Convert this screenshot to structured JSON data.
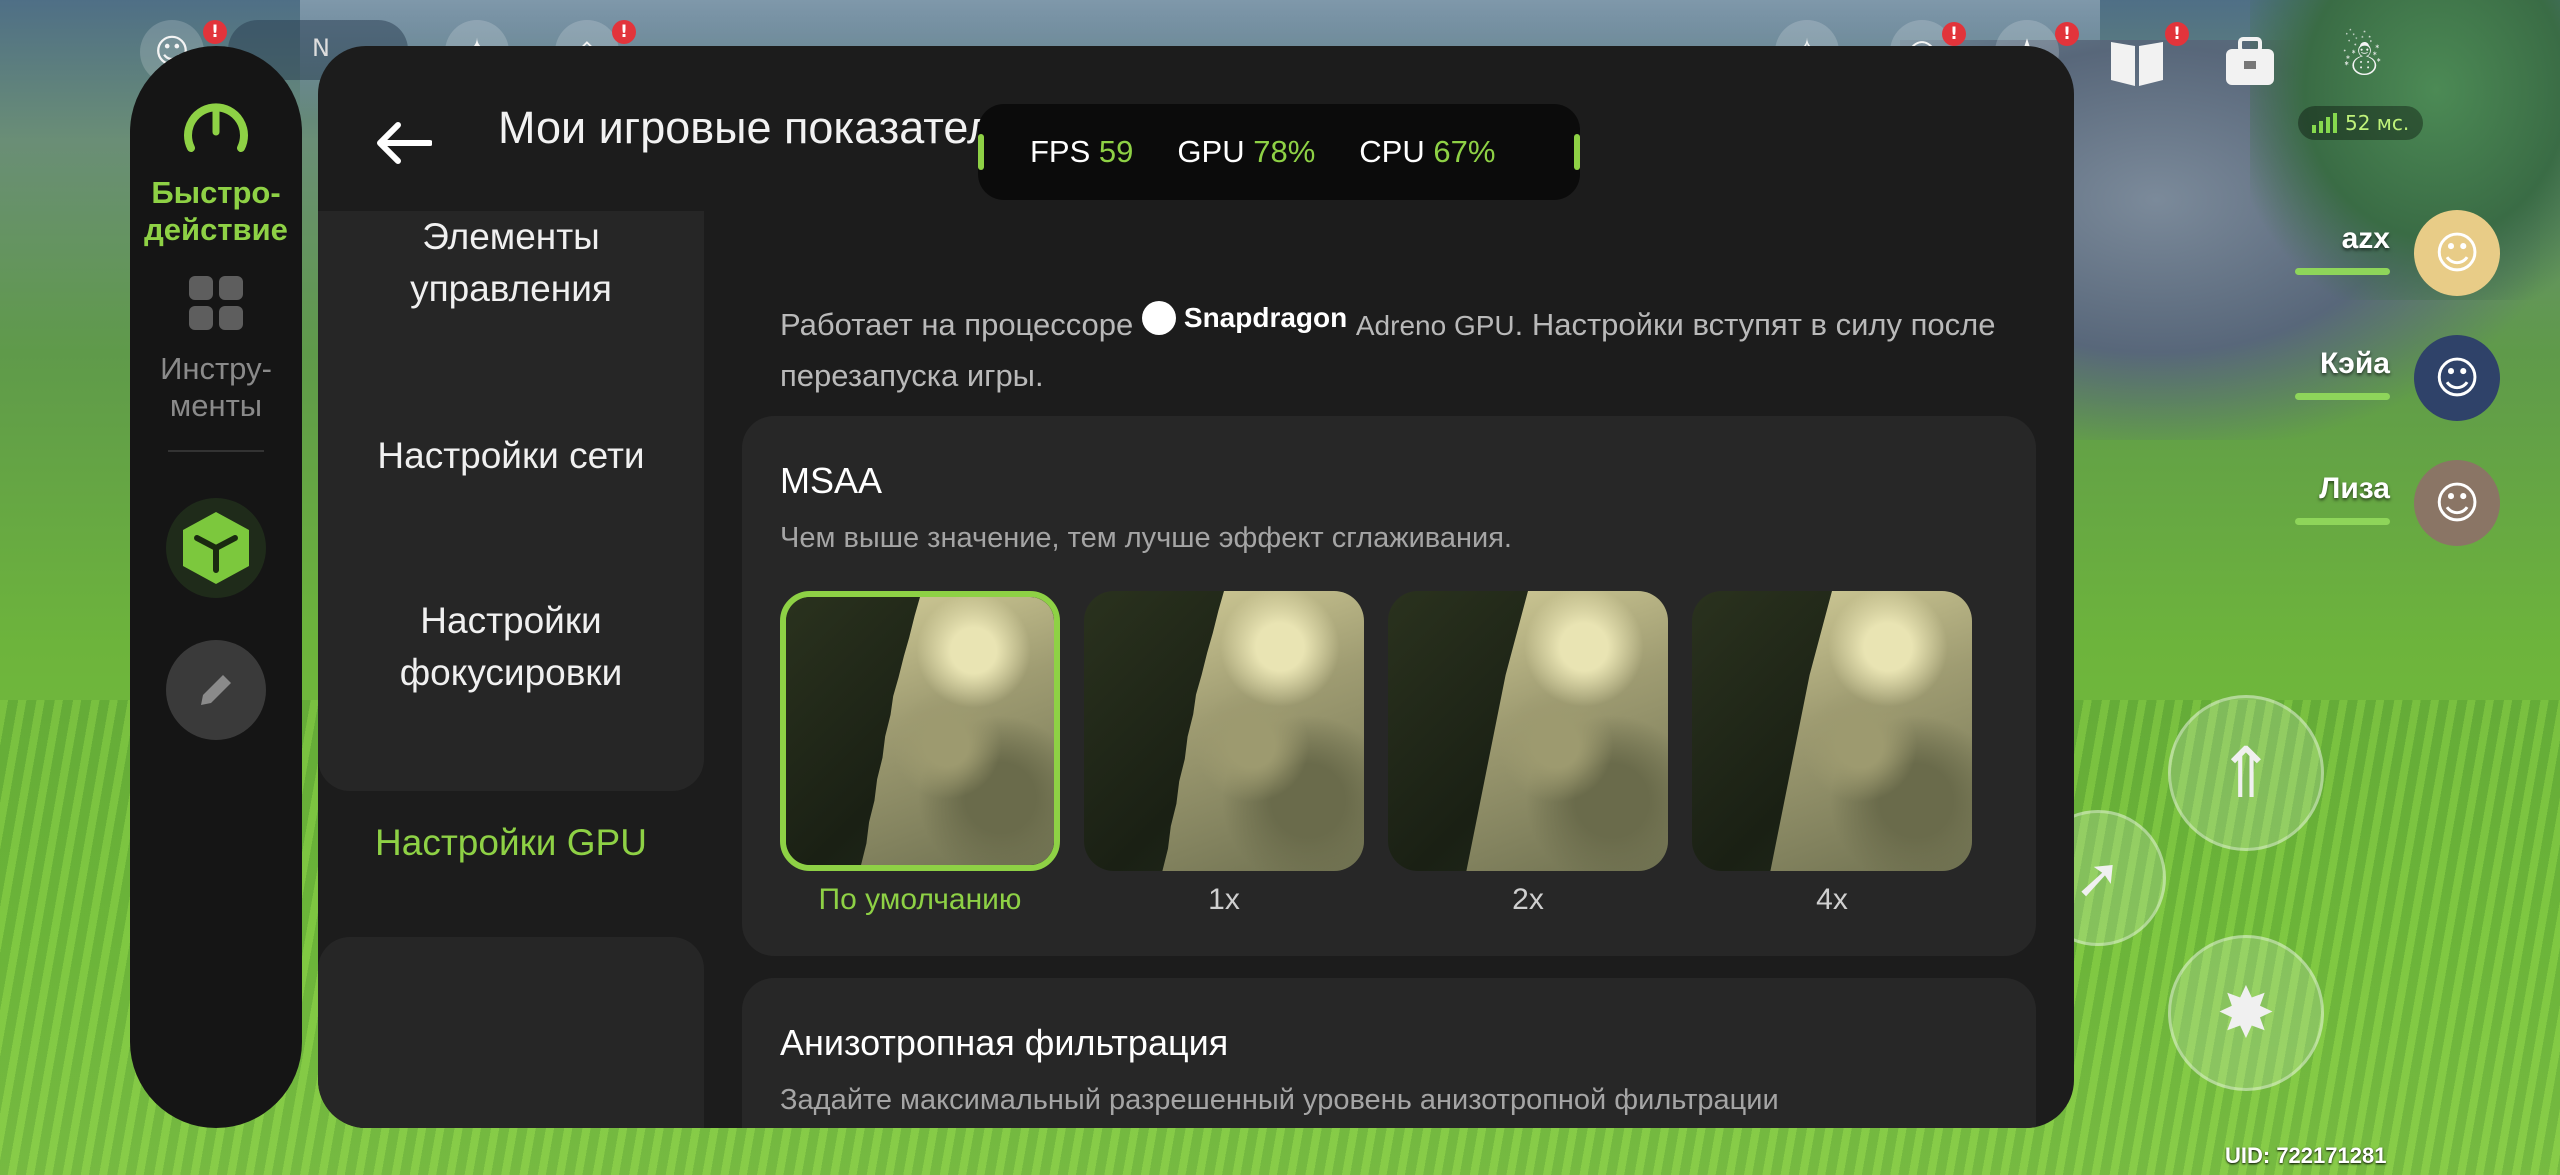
{
  "hud": {
    "compass_letter": "N",
    "ping": "52 мс.",
    "uid": "UID: 722171281",
    "notification_mark": "!"
  },
  "party": [
    {
      "name": "azx"
    },
    {
      "name": "Кэйа"
    },
    {
      "name": "Лиза"
    }
  ],
  "rail": {
    "performance_label": "Быстро-\nдействие",
    "tools_label": "Инстру-\nменты"
  },
  "panel": {
    "title": "Мои игровые показатели"
  },
  "perf_overlay": {
    "fps_label": "FPS",
    "fps_value": "59",
    "gpu_label": "GPU",
    "gpu_value": "78%",
    "cpu_label": "CPU",
    "cpu_value": "67%"
  },
  "subnav": {
    "items": [
      {
        "label": "Элементы управления"
      },
      {
        "label": "Настройки сети"
      },
      {
        "label": "Настройки фокусировки"
      },
      {
        "label": "Настройки GPU"
      }
    ]
  },
  "content": {
    "intro_prefix": "Работает на процессоре",
    "snapdragon": "Snapdragon",
    "adreno": "Adreno GPU",
    "intro_suffix": ". Настройки вступят в силу после перезапуска игры.",
    "msaa": {
      "title": "MSAA",
      "description": "Чем выше значение, тем лучше эффект сглаживания.",
      "options": [
        {
          "label": "По умолчанию"
        },
        {
          "label": "1x"
        },
        {
          "label": "2x"
        },
        {
          "label": "4x"
        }
      ]
    },
    "aniso": {
      "title": "Анизотропная фильтрация",
      "description": "Задайте максимальный разрешенный уровень анизотропной фильтрации"
    }
  },
  "colors": {
    "accent": "#8ed145",
    "panel_bg": "#1c1c1c",
    "card_bg": "#272727",
    "rail_bg": "#151515"
  }
}
